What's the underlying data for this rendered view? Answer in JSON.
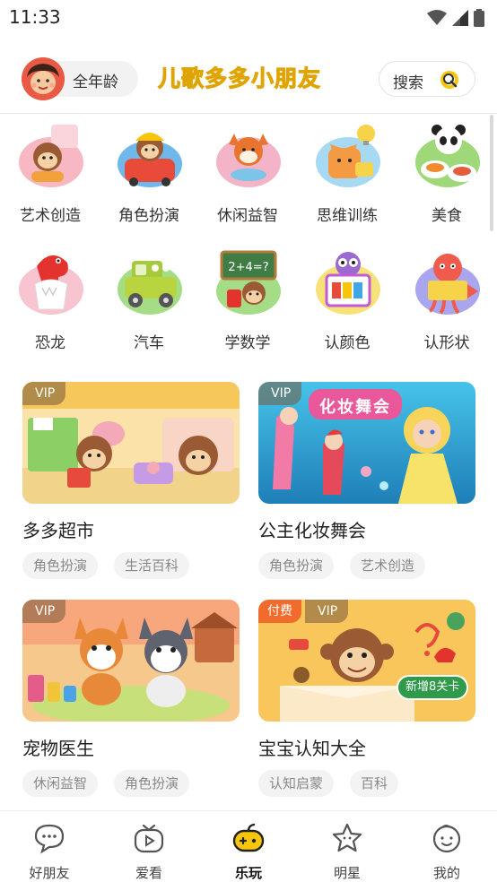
{
  "status_bar": {
    "time": "11:33"
  },
  "header": {
    "age_label": "全年龄",
    "brand": "儿歌多多小朋友",
    "search_label": "搜索"
  },
  "categories": [
    {
      "label": "艺术创造",
      "icon": "monkey-painter-icon"
    },
    {
      "label": "角色扮演",
      "icon": "fireman-monkey-icon"
    },
    {
      "label": "休闲益智",
      "icon": "fox-puzzle-icon"
    },
    {
      "label": "思维训练",
      "icon": "cat-lightbulb-icon"
    },
    {
      "label": "美食",
      "icon": "panda-food-icon"
    },
    {
      "label": "恐龙",
      "icon": "dinosaur-icon"
    },
    {
      "label": "汽车",
      "icon": "car-icon"
    },
    {
      "label": "学数学",
      "icon": "math-board-icon"
    },
    {
      "label": "认颜色",
      "icon": "owl-palette-icon"
    },
    {
      "label": "认形状",
      "icon": "octopus-shapes-icon"
    }
  ],
  "cards": [
    {
      "title": "多多超市",
      "badges": [
        "VIP"
      ],
      "tags": [
        "角色扮演",
        "生活百科"
      ]
    },
    {
      "title": "公主化妆舞会",
      "badges": [
        "VIP"
      ],
      "banner_text": "化妆舞会",
      "tags": [
        "角色扮演",
        "艺术创造"
      ]
    },
    {
      "title": "宠物医生",
      "badges": [
        "VIP"
      ],
      "tags": [
        "休闲益智",
        "角色扮演"
      ]
    },
    {
      "title": "宝宝认知大全",
      "badges": [
        "付费",
        "VIP"
      ],
      "promo": "新增8关卡",
      "tags": [
        "认知启蒙",
        "百科"
      ]
    }
  ],
  "nav": [
    {
      "label": "好朋友",
      "icon": "chat-bubble-icon",
      "active": false
    },
    {
      "label": "爱看",
      "icon": "tv-icon",
      "active": false
    },
    {
      "label": "乐玩",
      "icon": "gamepad-icon",
      "active": true
    },
    {
      "label": "明星",
      "icon": "star-icon",
      "active": false
    },
    {
      "label": "我的",
      "icon": "smiley-face-icon",
      "active": false
    }
  ],
  "colors": {
    "brand_yellow": "#f7c60b",
    "vip_badge": "#8a6a4a",
    "paid_badge": "#f06b2c",
    "tag_bg": "#f3f3f3",
    "promo_green": "#2f9a4a"
  }
}
